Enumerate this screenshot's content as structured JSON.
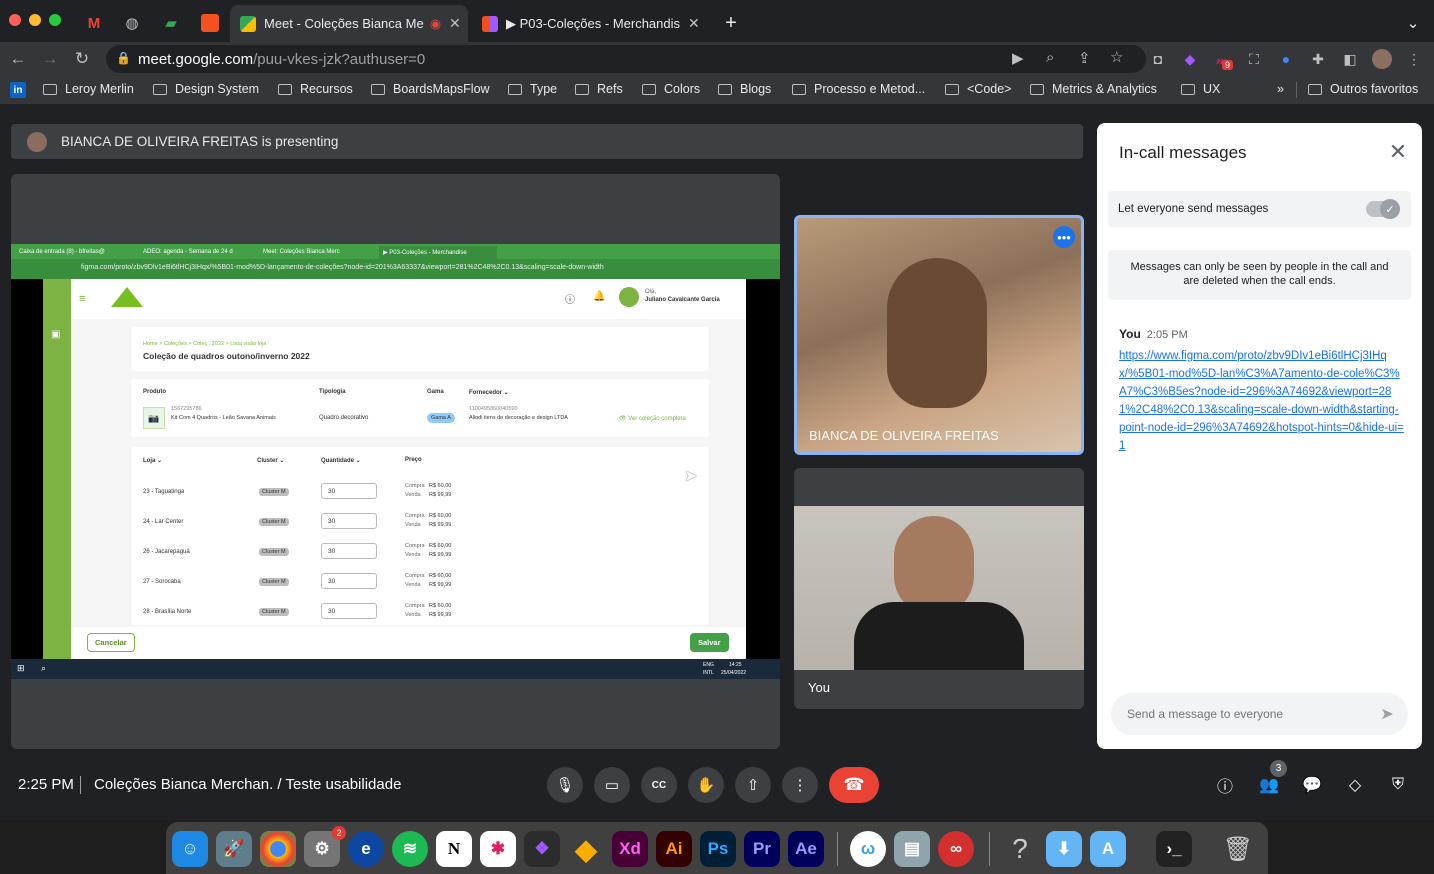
{
  "browser": {
    "tabs": [
      {
        "label": "Meet - Coleções Bianca Me",
        "active": true
      },
      {
        "label": "▶ P03-Coleções - Merchandis",
        "active": false
      }
    ],
    "url_host": "meet.google.com",
    "url_path": "/puu-vkes-jzk?authuser=0",
    "extension_badge": "9",
    "bookmarks": [
      "Leroy Merlin",
      "Design System",
      "Recursos",
      "BoardsMapsFlow",
      "Type",
      "Refs",
      "Colors",
      "Blogs",
      "Processo e Metod...",
      "<Code>",
      "Metrics & Analytics",
      "UX"
    ],
    "bookmarks_overflow": "»",
    "other_bookmarks": "Outros favoritos"
  },
  "meet": {
    "presenting_text": "BIANCA DE OLIVEIRA FREITAS is presenting",
    "tiles": [
      {
        "name": "BIANCA DE OLIVEIRA FREITAS"
      },
      {
        "name": "You"
      }
    ],
    "clock": "2:25 PM",
    "meeting_name": "Coleções Bianca Merchan. / Teste usabilidade",
    "participant_count": "3"
  },
  "shared_screen": {
    "tabs": [
      "Caixa de entrada (8) - bfreitas@",
      "ADEO: agenda - Semana de 24 d",
      "Meet: Coleções Bianca Merc",
      "▶ P03-Coleções - Merchandise"
    ],
    "url": "figma.com/proto/zbv9Dlv1eBi6tlHCj3IHqx/%5B01-mod%5D-lançamento-de-coleções?node-id=201%3A63337&viewport=281%2C48%2C0.13&scaling=scale-down-width",
    "user_greeting": "Olá,",
    "user_name": "Juliano Cavalcante Garcia",
    "breadcrumb": "Home > Coleções > Coleç...2022 > Lista visão loja",
    "page_title": "Coleção de quadros outono/inverno 2022",
    "product_headers": [
      "Produto",
      "Tipologia",
      "Gama",
      "Fornecedor ⌄"
    ],
    "product": {
      "code": "1567295786",
      "name": "Kit Com 4 Quadros - Leão Savana Animais",
      "tipologia": "Quadro decorativo",
      "gama": "Gama A",
      "fornecedor_code": "1100495860040590",
      "fornecedor": "Allodi itens de decoração e design LTDA",
      "link": "👁 Ver coleção completa"
    },
    "store_headers": [
      "Loja ⌄",
      "Cluster ⌄",
      "Quantidade ⌄",
      "Preço"
    ],
    "stores": [
      {
        "loja": "23 - Taguatinga",
        "cluster": "Cluster M",
        "qty": "30",
        "compra": "R$ 60,00",
        "venda": "R$ 99,99"
      },
      {
        "loja": "24 - Lar Center",
        "cluster": "Cluster M",
        "qty": "30",
        "compra": "R$ 60,00",
        "venda": "R$ 99,99"
      },
      {
        "loja": "26 - Jacarepaguá",
        "cluster": "Cluster M",
        "qty": "30",
        "compra": "R$ 60,00",
        "venda": "R$ 99,99"
      },
      {
        "loja": "27 - Sorocaba",
        "cluster": "Cluster M",
        "qty": "30",
        "compra": "R$ 60,00",
        "venda": "R$ 99,99"
      },
      {
        "loja": "28 - Brasília Norte",
        "cluster": "Cluster M",
        "qty": "30",
        "compra": "R$ 60,00",
        "venda": "R$ 99,99"
      }
    ],
    "compra_label": "Compra",
    "venda_label": "Venda",
    "cancel_label": "Cancelar",
    "save_label": "Salvar",
    "taskbar_lang": "ENG",
    "taskbar_intl": "INTL",
    "taskbar_time": "14:25",
    "taskbar_date": "25/04/2022"
  },
  "chat": {
    "title": "In-call messages",
    "allow_label": "Let everyone send messages",
    "notice": "Messages can only be seen by people in the call and are deleted when the call ends.",
    "message": {
      "sender": "You",
      "time": "2:05 PM",
      "text": "https://www.figma.com/proto/zbv9DIv1eBi6tlHCj3IHqx/%5B01-mod%5D-lan%C3%A7amento-de-cole%C3%A7%C3%B5es?node-id=296%3A74692&viewport=281%2C48%2C0.13&scaling=scale-down-width&starting-point-node-id=296%3A74692&hotspot-hints=0&hide-ui=1"
    },
    "input_placeholder": "Send a message to everyone"
  },
  "dock": {
    "settings_badge": "2",
    "labels": [
      "Xd",
      "Ai",
      "Ps",
      "Pr",
      "Ae"
    ]
  },
  "colors": {
    "meet_bg": "#202124",
    "end_call": "#ea4335",
    "chat_link": "#1a73e8",
    "leroy_green": "#7cb342",
    "active_tile_border": "#8ab4f8"
  }
}
